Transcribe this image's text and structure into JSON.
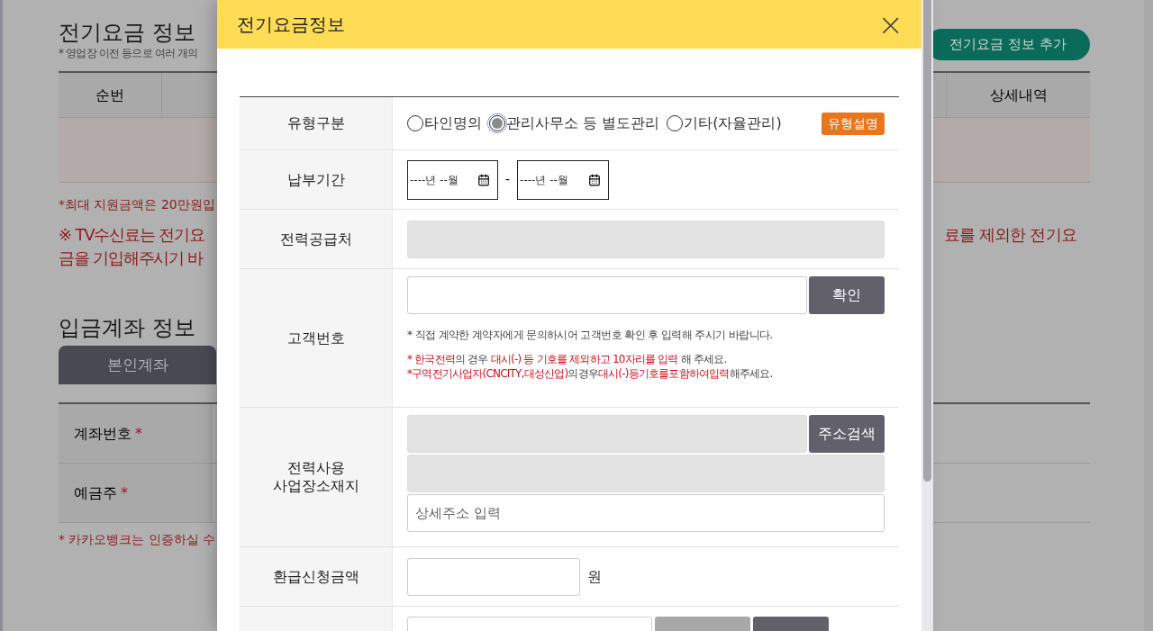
{
  "page": {
    "title": "전기요금 정보",
    "subtitle": "* 영업장 이전 등으로 여러 개의",
    "add_button": "전기요금 정보 추가",
    "table": {
      "columns": [
        "순번",
        "상세내역"
      ]
    },
    "max_note": "*최대 지원금액은 20만원입",
    "tv_notice_left": [
      "※ TV수신료는 전기요",
      "금을 기입해주시기 바"
    ],
    "tv_notice_right": "료를 제외한 전기요",
    "account": {
      "title": "입금계좌 정보",
      "tabs": [
        {
          "label": "본인계좌",
          "selected": true
        }
      ],
      "fields": [
        "계좌번호",
        "예금주"
      ],
      "required_mark": "*",
      "note": "* 카카오뱅크는 인증하실 수"
    }
  },
  "modal": {
    "title": "전기요금정보",
    "close": "×",
    "type_row": {
      "label": "유형구분",
      "options": [
        {
          "label": "타인명의",
          "selected": false
        },
        {
          "label": "관리사무소 등 별도관리",
          "selected": true
        },
        {
          "label": "기타(자율관리)",
          "selected": false
        }
      ],
      "help_badge": "유형설명"
    },
    "period_row": {
      "label": "납부기간",
      "start": "----년 --월",
      "separator": "-",
      "end": "----년 --월"
    },
    "supplier_row": {
      "label": "전력공급처"
    },
    "customer_row": {
      "label": "고객번호",
      "button": "확인",
      "note": "* 직접 계약한 계약자에게 문의하시어 고객번호 확인 후 입력해 주시기 바랍니다.",
      "rules": [
        [
          {
            "text": "* 한국전력",
            "highlight": true
          },
          {
            "text": "의 경우 ",
            "highlight": false
          },
          {
            "text": "대시(-) 등 기호를 제외하고 10자리를 입력",
            "highlight": true
          },
          {
            "text": " 해 주세요.",
            "highlight": false
          }
        ],
        [
          {
            "text": "*구역전기사업자(CNCITY,대성산업)",
            "highlight": true
          },
          {
            "text": "의경우",
            "highlight": false
          },
          {
            "text": "대시(-)등기호를포함하여입력",
            "highlight": true
          },
          {
            "text": "해주세요.",
            "highlight": false
          }
        ]
      ]
    },
    "address_row": {
      "label": [
        "전력사용",
        "사업장소재지"
      ],
      "button": "주소검색",
      "detail_placeholder": "상세주소 입력"
    },
    "refund_row": {
      "label": "환급신청금액",
      "unit": "원"
    }
  }
}
